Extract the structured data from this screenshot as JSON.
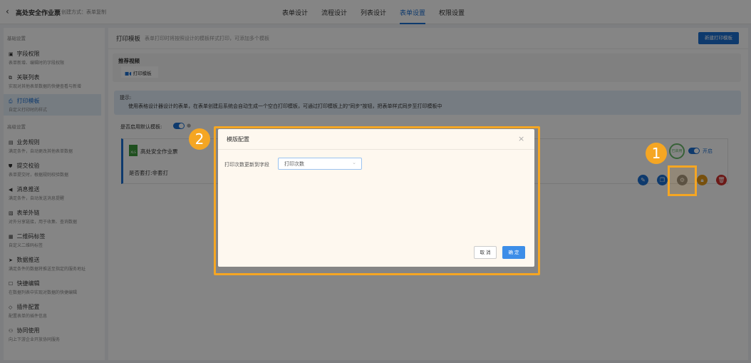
{
  "header": {
    "back": "‹",
    "title": "高处安全作业票",
    "create_mode": "创建方式：表单复制",
    "tabs": [
      {
        "label": "表单设计"
      },
      {
        "label": "流程设计"
      },
      {
        "label": "列表设计"
      },
      {
        "label": "表单设置"
      },
      {
        "label": "权限设置"
      }
    ],
    "active_tab": "表单设置"
  },
  "sidebar": {
    "basic_label": "基础设置",
    "advanced_label": "高级设置",
    "basic": [
      {
        "name": "字段权限",
        "desc": "表单新增、编辑时的字段权限",
        "icon": "▣"
      },
      {
        "name": "关联列表",
        "desc": "实现对其他表单数据的快捷查看与新增",
        "icon": "⧉"
      },
      {
        "name": "打印模板",
        "desc": "自定义打印时的样式",
        "icon": "⎙"
      }
    ],
    "advanced": [
      {
        "name": "业务规则",
        "desc": "满足条件，自动更改其他表单数据",
        "icon": "▤"
      },
      {
        "name": "提交校验",
        "desc": "表单提交时，根据规则校验数据",
        "icon": "⛊"
      },
      {
        "name": "消息推送",
        "desc": "满足条件，自动发送消息提醒",
        "icon": "◀"
      },
      {
        "name": "表单外链",
        "desc": "对外分享链接，用于收集、查询数据",
        "icon": "▧"
      },
      {
        "name": "二维码标签",
        "desc": "自定义二维码标签",
        "icon": "▦"
      },
      {
        "name": "数据推送",
        "desc": "满足条件的数据将推送至指定的服务地址",
        "icon": "➤"
      },
      {
        "name": "快捷编辑",
        "desc": "在数据列表中实现对数据的快捷编辑",
        "icon": "☐"
      },
      {
        "name": "插件配置",
        "desc": "配置表单的插件信息",
        "icon": "◇"
      },
      {
        "name": "协同使用",
        "desc": "向上下游企业开放协同服务",
        "icon": "⚇"
      }
    ]
  },
  "main": {
    "title": "打印模板",
    "subtitle": "表单打印时将按照设计的模板样式打印，可添加多个模板",
    "new_button": "新建打印模板",
    "video_title": "推荐视频",
    "video_item": "打印模板",
    "tip_title": "提示:",
    "tip_text": "使用表格设计器设计的表单，在表单创建后系统会自动生成一个空白打印模板，可通过打印模板上的\"同步\"按钮，把表单样式同步至打印模板中",
    "default_label": "是否启用默认模板:",
    "template": {
      "name": "高处安全作业票",
      "file_badge": "XLS",
      "stamp": "已启用",
      "toggle_label": "开启",
      "meta": "是否套打:非套打"
    }
  },
  "modal": {
    "title": "模版配置",
    "close": "×",
    "field_label": "打印次数更新到字段",
    "field_value": "打印次数",
    "cancel": "取 消",
    "ok": "确 定"
  },
  "annotations": {
    "step1": "1",
    "step2": "2"
  },
  "colors": {
    "accent": "#1c6fd1",
    "highlight": "#f5a623"
  }
}
